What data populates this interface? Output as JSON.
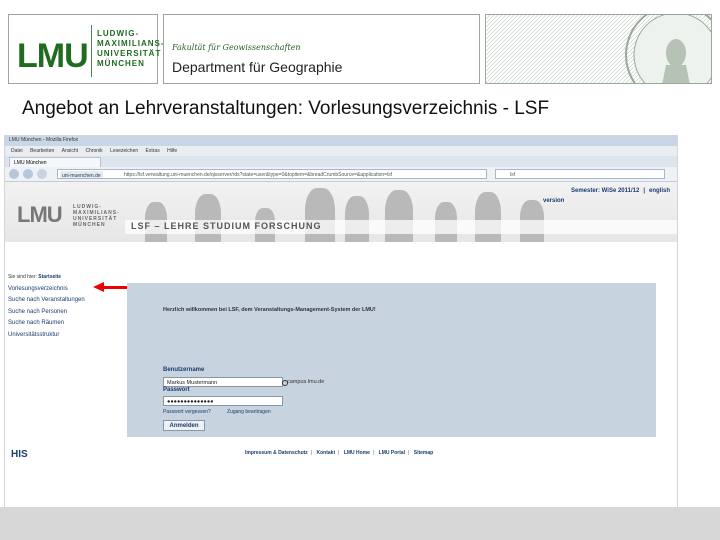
{
  "header": {
    "lmu_short": "LMU",
    "lmu_words": [
      "LUDWIG-",
      "MAXIMILIANS-",
      "UNIVERSITÄT",
      "MÜNCHEN"
    ],
    "faculty": "Fakultät für Geowissenschaften",
    "department": "Department für Geographie"
  },
  "slide_title": "Angebot an Lehrveranstaltungen: Vorlesungsverzeichnis - LSF",
  "browser": {
    "window_title": "LMU München - Mozilla Firefox",
    "menu": [
      "Datei",
      "Bearbeiten",
      "Ansicht",
      "Chronik",
      "Lesezeichen",
      "Extras",
      "Hilfe"
    ],
    "tab_label": "LMU München",
    "site_tag": "uni-muenchen.de",
    "url": "https://lsf.verwaltung.uni-muenchen.de/qisserver/rds?state=user&type=0&topitem=&breadCrumbSource=&application=lsf",
    "search_placeholder": "lsf"
  },
  "lsf": {
    "logo": "LMU",
    "logo_words": [
      "LUDWIG-",
      "MAXIMILIANS-",
      "UNIVERSITÄT",
      "MÜNCHEN"
    ],
    "band_text": "LSF – LEHRE STUDIUM FORSCHUNG",
    "semester_label": "Semester: WiSe 2011/12",
    "english_link": "english",
    "english_link_2": "version",
    "breadcrumb_prefix": "Sie sind hier:",
    "breadcrumb_current": "Startseite",
    "nav": [
      "Vorlesungsverzeichnis",
      "Suche nach Veranstaltungen",
      "Suche nach Personen",
      "Suche nach Räumen",
      "Universitätsstruktur"
    ],
    "welcome": "Herzlich willkommen bei LSF, dem Veranstaltungs-Management-System der LMU!",
    "username_label": "Benutzername",
    "username_value": "Markus Mustermann",
    "domain": "campus.lmu.de",
    "password_label": "Passwort",
    "password_value": "●●●●●●●●●●●●●●",
    "forgot_link": "Passwort vergessen?",
    "apply_link": "Zugang beantragen",
    "login_button": "Anmelden",
    "footer_logo": "HIS",
    "footer_links": [
      "Impressum & Datenschutz",
      "Kontakt",
      "LMU Home",
      "LMU Portal",
      "Sitemap"
    ]
  },
  "colors": {
    "lmu_green": "#1f6b1f",
    "arrow_red": "#e00000",
    "content_bg": "#c7d3de"
  }
}
